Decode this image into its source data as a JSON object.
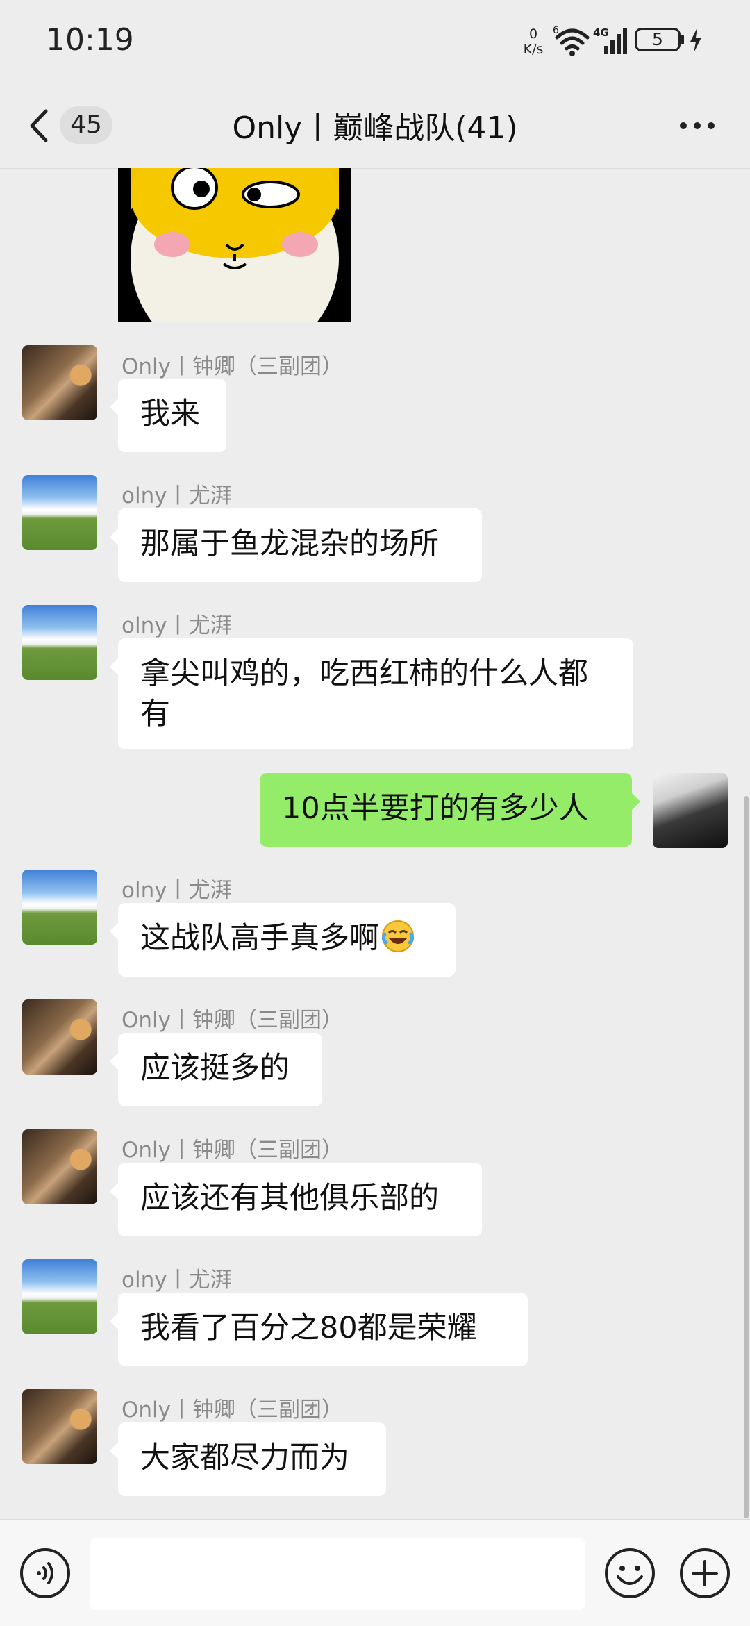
{
  "status_bar": {
    "time": "10:19",
    "net_speed_value": "0",
    "net_speed_unit": "K/s",
    "network_type": "4G",
    "wifi_label": "6",
    "battery": "5"
  },
  "header": {
    "unread_count": "45",
    "title": "Only丨巅峰战队(41)"
  },
  "messages": [
    {
      "sender": "Only丨钟卿（三副团）",
      "text": "我来"
    },
    {
      "sender": "olny丨尤湃",
      "text": "那属于鱼龙混杂的场所"
    },
    {
      "sender": "olny丨尤湃",
      "text": "拿尖叫鸡的，吃西红柿的什么人都有"
    },
    {
      "sender": "me",
      "text": "10点半要打的有多少人"
    },
    {
      "sender": "olny丨尤湃",
      "text": "这战队高手真多啊"
    },
    {
      "sender": "Only丨钟卿（三副团）",
      "text": "应该挺多的"
    },
    {
      "sender": "Only丨钟卿（三副团）",
      "text": "应该还有其他俱乐部的"
    },
    {
      "sender": "olny丨尤湃",
      "text": "我看了百分之80都是荣耀"
    },
    {
      "sender": "Only丨钟卿（三副团）",
      "text": "大家都尽力而为"
    }
  ],
  "input": {
    "value": ""
  },
  "icons": {
    "back": "chevron-left-icon",
    "more": "more-dots-icon",
    "voice": "voice-icon",
    "emoji": "emoji-icon",
    "plus": "plus-icon"
  },
  "colors": {
    "background": "#ededed",
    "my_bubble": "#95ec69",
    "other_bubble": "#ffffff"
  }
}
